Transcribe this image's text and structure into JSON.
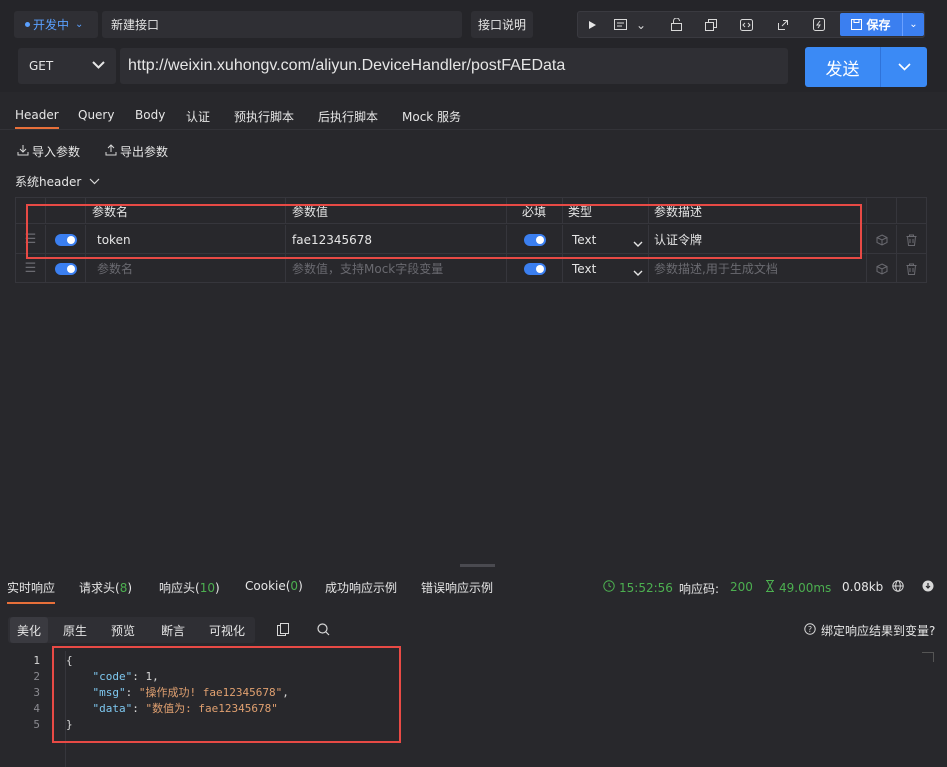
{
  "top": {
    "env_label": "开发中",
    "api_name": "新建接口",
    "doc_label": "接口说明",
    "save_label": "保存"
  },
  "request": {
    "method": "GET",
    "url": "http://weixin.xuhongv.com/aliyun.DeviceHandler/postFAEData",
    "send_label": "发送"
  },
  "tabs": [
    "Header",
    "Query",
    "Body",
    "认证",
    "预执行脚本",
    "后执行脚本",
    "Mock 服务"
  ],
  "actions": {
    "import": "导入参数",
    "export": "导出参数"
  },
  "sys_header": "系统header",
  "table": {
    "columns": [
      "参数名",
      "参数值",
      "必填",
      "类型",
      "参数描述"
    ],
    "rows": [
      {
        "name": "token",
        "value": "fae12345678",
        "type": "Text",
        "desc": "认证令牌"
      }
    ],
    "new_row": {
      "name_placeholder": "参数名",
      "value_placeholder": "参数值，支持Mock字段变量",
      "type": "Text",
      "desc_placeholder": "参数描述,用于生成文档"
    }
  },
  "response": {
    "tabs": {
      "realtime": "实时响应",
      "req_headers": "请求头(",
      "req_headers_count": "8",
      "resp_headers": "响应头(",
      "resp_headers_count": "10",
      "cookie": "Cookie(",
      "cookie_count": "0",
      "close_paren": ")",
      "success_example": "成功响应示例",
      "error_example": "错误响应示例"
    },
    "status": {
      "time": "15:52:56",
      "code_label": "响应码:",
      "code": "200",
      "duration": "49.00ms",
      "size": "0.08kb"
    },
    "sub_tabs": [
      "美化",
      "原生",
      "预览",
      "断言",
      "可视化"
    ],
    "bind_label": "绑定响应结果到变量?",
    "code_lines": {
      "l1": "{",
      "l2_key": "\"code\"",
      "l2_val": "1",
      "l3_key": "\"msg\"",
      "l3_val": "\"操作成功! fae12345678\"",
      "l4_key": "\"data\"",
      "l4_val": "\"数值为: fae12345678\"",
      "l5": "}"
    },
    "line_numbers": [
      "1",
      "2",
      "3",
      "4",
      "5"
    ]
  },
  "colors": {
    "accent": "#3b7ff0",
    "tab_active": "#e8703a",
    "status_green": "#4caf50",
    "annotation_red": "#e84a45"
  },
  "icons": [
    "play-icon",
    "doc-icon",
    "lock-icon",
    "copy-icon",
    "code-icon",
    "share-icon",
    "flash-icon",
    "save-icon",
    "import-icon",
    "export-icon",
    "grip-icon",
    "cube-icon",
    "trash-icon",
    "clock-icon",
    "hourglass-icon",
    "globe-icon",
    "download-icon",
    "clipboard-icon",
    "search-icon",
    "help-icon"
  ]
}
